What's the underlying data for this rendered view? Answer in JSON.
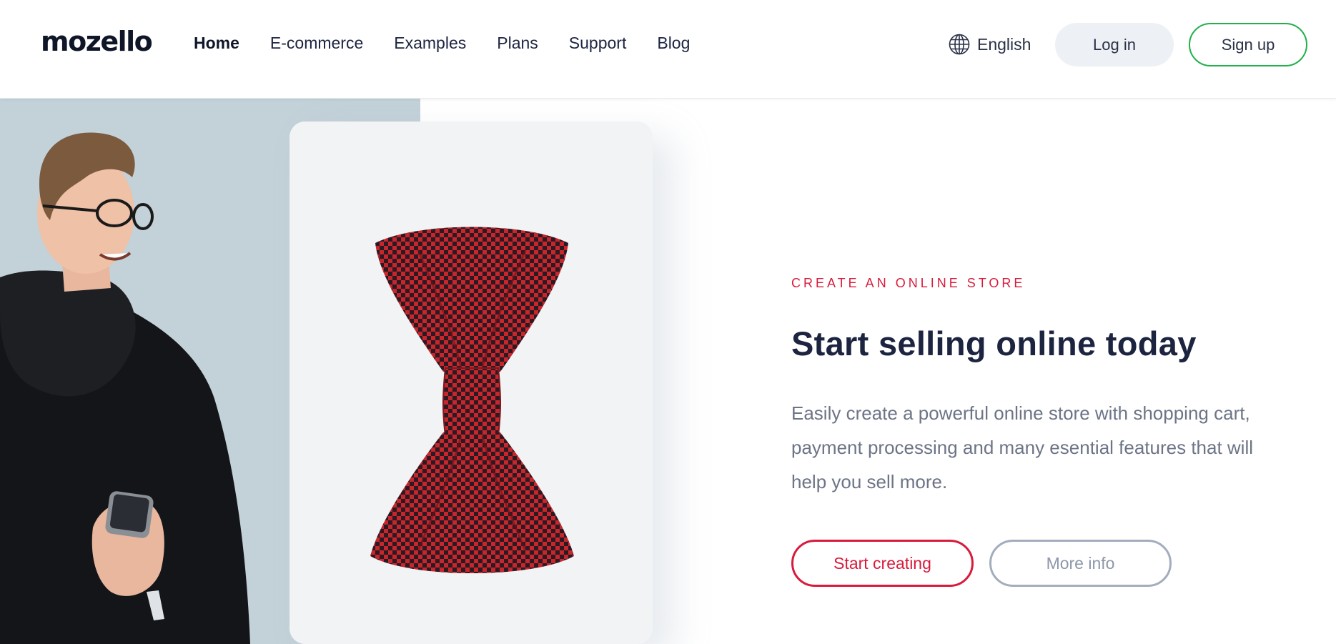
{
  "brand": {
    "logo_text": "mozello"
  },
  "nav": {
    "items": [
      {
        "label": "Home",
        "active": true
      },
      {
        "label": "E-commerce",
        "active": false
      },
      {
        "label": "Examples",
        "active": false
      },
      {
        "label": "Plans",
        "active": false
      },
      {
        "label": "Support",
        "active": false
      },
      {
        "label": "Blog",
        "active": false
      }
    ]
  },
  "header_actions": {
    "language_icon": "globe-icon",
    "language_label": "English",
    "login_label": "Log in",
    "signup_label": "Sign up"
  },
  "hero": {
    "eyebrow": "CREATE AN ONLINE STORE",
    "headline": "Start selling online today",
    "description": "Easily create a powerful online store with shopping cart, payment processing and many esential features that will help you sell more.",
    "primary_cta": "Start creating",
    "secondary_cta": "More info"
  },
  "colors": {
    "accent_red": "#d81b3c",
    "signup_green": "#22b04b",
    "headline_navy": "#1c2440",
    "body_gray": "#6c7486"
  }
}
